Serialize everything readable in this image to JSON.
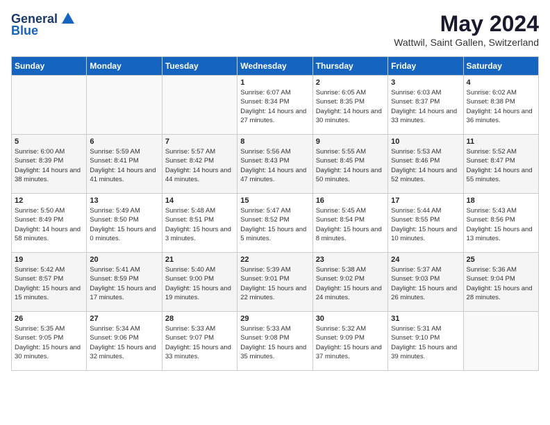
{
  "header": {
    "logo_general": "General",
    "logo_blue": "Blue",
    "month_year": "May 2024",
    "location": "Wattwil, Saint Gallen, Switzerland"
  },
  "days_of_week": [
    "Sunday",
    "Monday",
    "Tuesday",
    "Wednesday",
    "Thursday",
    "Friday",
    "Saturday"
  ],
  "weeks": [
    [
      {
        "num": "",
        "sunrise": "",
        "sunset": "",
        "daylight": ""
      },
      {
        "num": "",
        "sunrise": "",
        "sunset": "",
        "daylight": ""
      },
      {
        "num": "",
        "sunrise": "",
        "sunset": "",
        "daylight": ""
      },
      {
        "num": "1",
        "sunrise": "Sunrise: 6:07 AM",
        "sunset": "Sunset: 8:34 PM",
        "daylight": "Daylight: 14 hours and 27 minutes."
      },
      {
        "num": "2",
        "sunrise": "Sunrise: 6:05 AM",
        "sunset": "Sunset: 8:35 PM",
        "daylight": "Daylight: 14 hours and 30 minutes."
      },
      {
        "num": "3",
        "sunrise": "Sunrise: 6:03 AM",
        "sunset": "Sunset: 8:37 PM",
        "daylight": "Daylight: 14 hours and 33 minutes."
      },
      {
        "num": "4",
        "sunrise": "Sunrise: 6:02 AM",
        "sunset": "Sunset: 8:38 PM",
        "daylight": "Daylight: 14 hours and 36 minutes."
      }
    ],
    [
      {
        "num": "5",
        "sunrise": "Sunrise: 6:00 AM",
        "sunset": "Sunset: 8:39 PM",
        "daylight": "Daylight: 14 hours and 38 minutes."
      },
      {
        "num": "6",
        "sunrise": "Sunrise: 5:59 AM",
        "sunset": "Sunset: 8:41 PM",
        "daylight": "Daylight: 14 hours and 41 minutes."
      },
      {
        "num": "7",
        "sunrise": "Sunrise: 5:57 AM",
        "sunset": "Sunset: 8:42 PM",
        "daylight": "Daylight: 14 hours and 44 minutes."
      },
      {
        "num": "8",
        "sunrise": "Sunrise: 5:56 AM",
        "sunset": "Sunset: 8:43 PM",
        "daylight": "Daylight: 14 hours and 47 minutes."
      },
      {
        "num": "9",
        "sunrise": "Sunrise: 5:55 AM",
        "sunset": "Sunset: 8:45 PM",
        "daylight": "Daylight: 14 hours and 50 minutes."
      },
      {
        "num": "10",
        "sunrise": "Sunrise: 5:53 AM",
        "sunset": "Sunset: 8:46 PM",
        "daylight": "Daylight: 14 hours and 52 minutes."
      },
      {
        "num": "11",
        "sunrise": "Sunrise: 5:52 AM",
        "sunset": "Sunset: 8:47 PM",
        "daylight": "Daylight: 14 hours and 55 minutes."
      }
    ],
    [
      {
        "num": "12",
        "sunrise": "Sunrise: 5:50 AM",
        "sunset": "Sunset: 8:49 PM",
        "daylight": "Daylight: 14 hours and 58 minutes."
      },
      {
        "num": "13",
        "sunrise": "Sunrise: 5:49 AM",
        "sunset": "Sunset: 8:50 PM",
        "daylight": "Daylight: 15 hours and 0 minutes."
      },
      {
        "num": "14",
        "sunrise": "Sunrise: 5:48 AM",
        "sunset": "Sunset: 8:51 PM",
        "daylight": "Daylight: 15 hours and 3 minutes."
      },
      {
        "num": "15",
        "sunrise": "Sunrise: 5:47 AM",
        "sunset": "Sunset: 8:52 PM",
        "daylight": "Daylight: 15 hours and 5 minutes."
      },
      {
        "num": "16",
        "sunrise": "Sunrise: 5:45 AM",
        "sunset": "Sunset: 8:54 PM",
        "daylight": "Daylight: 15 hours and 8 minutes."
      },
      {
        "num": "17",
        "sunrise": "Sunrise: 5:44 AM",
        "sunset": "Sunset: 8:55 PM",
        "daylight": "Daylight: 15 hours and 10 minutes."
      },
      {
        "num": "18",
        "sunrise": "Sunrise: 5:43 AM",
        "sunset": "Sunset: 8:56 PM",
        "daylight": "Daylight: 15 hours and 13 minutes."
      }
    ],
    [
      {
        "num": "19",
        "sunrise": "Sunrise: 5:42 AM",
        "sunset": "Sunset: 8:57 PM",
        "daylight": "Daylight: 15 hours and 15 minutes."
      },
      {
        "num": "20",
        "sunrise": "Sunrise: 5:41 AM",
        "sunset": "Sunset: 8:59 PM",
        "daylight": "Daylight: 15 hours and 17 minutes."
      },
      {
        "num": "21",
        "sunrise": "Sunrise: 5:40 AM",
        "sunset": "Sunset: 9:00 PM",
        "daylight": "Daylight: 15 hours and 19 minutes."
      },
      {
        "num": "22",
        "sunrise": "Sunrise: 5:39 AM",
        "sunset": "Sunset: 9:01 PM",
        "daylight": "Daylight: 15 hours and 22 minutes."
      },
      {
        "num": "23",
        "sunrise": "Sunrise: 5:38 AM",
        "sunset": "Sunset: 9:02 PM",
        "daylight": "Daylight: 15 hours and 24 minutes."
      },
      {
        "num": "24",
        "sunrise": "Sunrise: 5:37 AM",
        "sunset": "Sunset: 9:03 PM",
        "daylight": "Daylight: 15 hours and 26 minutes."
      },
      {
        "num": "25",
        "sunrise": "Sunrise: 5:36 AM",
        "sunset": "Sunset: 9:04 PM",
        "daylight": "Daylight: 15 hours and 28 minutes."
      }
    ],
    [
      {
        "num": "26",
        "sunrise": "Sunrise: 5:35 AM",
        "sunset": "Sunset: 9:05 PM",
        "daylight": "Daylight: 15 hours and 30 minutes."
      },
      {
        "num": "27",
        "sunrise": "Sunrise: 5:34 AM",
        "sunset": "Sunset: 9:06 PM",
        "daylight": "Daylight: 15 hours and 32 minutes."
      },
      {
        "num": "28",
        "sunrise": "Sunrise: 5:33 AM",
        "sunset": "Sunset: 9:07 PM",
        "daylight": "Daylight: 15 hours and 33 minutes."
      },
      {
        "num": "29",
        "sunrise": "Sunrise: 5:33 AM",
        "sunset": "Sunset: 9:08 PM",
        "daylight": "Daylight: 15 hours and 35 minutes."
      },
      {
        "num": "30",
        "sunrise": "Sunrise: 5:32 AM",
        "sunset": "Sunset: 9:09 PM",
        "daylight": "Daylight: 15 hours and 37 minutes."
      },
      {
        "num": "31",
        "sunrise": "Sunrise: 5:31 AM",
        "sunset": "Sunset: 9:10 PM",
        "daylight": "Daylight: 15 hours and 39 minutes."
      },
      {
        "num": "",
        "sunrise": "",
        "sunset": "",
        "daylight": ""
      }
    ]
  ]
}
